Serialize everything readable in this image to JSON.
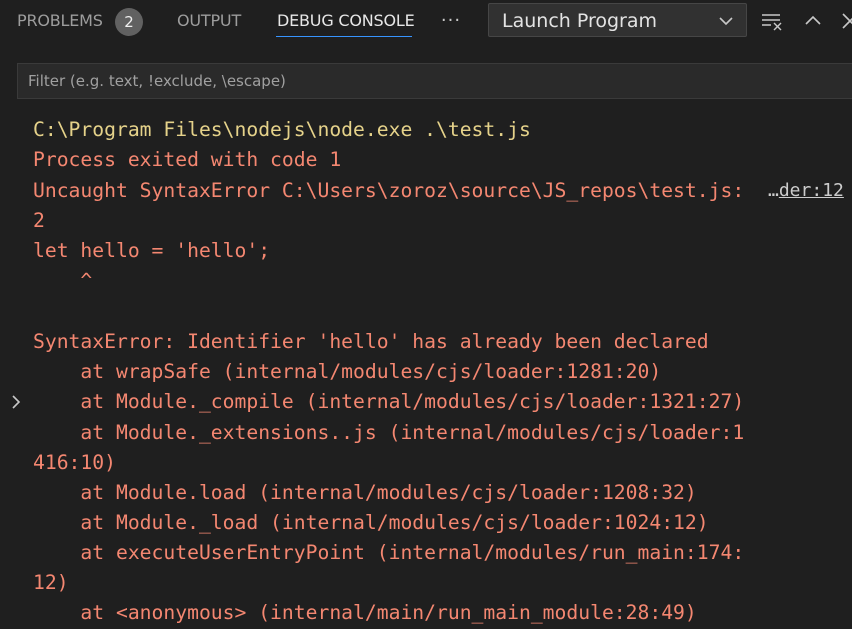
{
  "tabs": {
    "problems_label": "PROBLEMS",
    "problems_count": "2",
    "output_label": "OUTPUT",
    "debug_console_label": "DEBUG CONSOLE",
    "more_label": "···"
  },
  "launch_config": {
    "selected": "Launch Program"
  },
  "filter": {
    "placeholder": "Filter (e.g. text, !exclude, \\escape)",
    "value": ""
  },
  "console": {
    "lines": [
      "C:\\Program Files\\nodejs\\node.exe .\\test.js",
      "Process exited with code 1",
      "Uncaught SyntaxError C:\\Users\\zoroz\\source\\JS_repos\\test.js:",
      "2",
      "let hello = 'hello';",
      "    ^",
      "",
      "SyntaxError: Identifier 'hello' has already been declared",
      "    at wrapSafe (internal/modules/cjs/loader:1281:20)",
      "    at Module._compile (internal/modules/cjs/loader:1321:27)",
      "    at Module._extensions..js (internal/modules/cjs/loader:1",
      "416:10)",
      "    at Module.load (internal/modules/cjs/loader:1208:32)",
      "    at Module._load (internal/modules/cjs/loader:1024:12)",
      "    at executeUserEntryPoint (internal/modules/run_main:174:",
      "12)",
      "    at <anonymous> (internal/main/run_main_module:28:49)"
    ],
    "source_link_prefix": "…",
    "source_link_text": "der:12"
  },
  "icons": {
    "more": "ellipsis-icon",
    "dropdown": "chevron-down-icon",
    "clear": "clear-console-icon",
    "maximize": "chevron-up-icon",
    "close": "close-icon",
    "expand": "chevron-right-icon"
  },
  "colors": {
    "background": "#1f1f1f",
    "error_text": "#f48771",
    "command_text": "#e5d28a",
    "active_tab_underline": "#3794ff",
    "badge": "#616161"
  }
}
